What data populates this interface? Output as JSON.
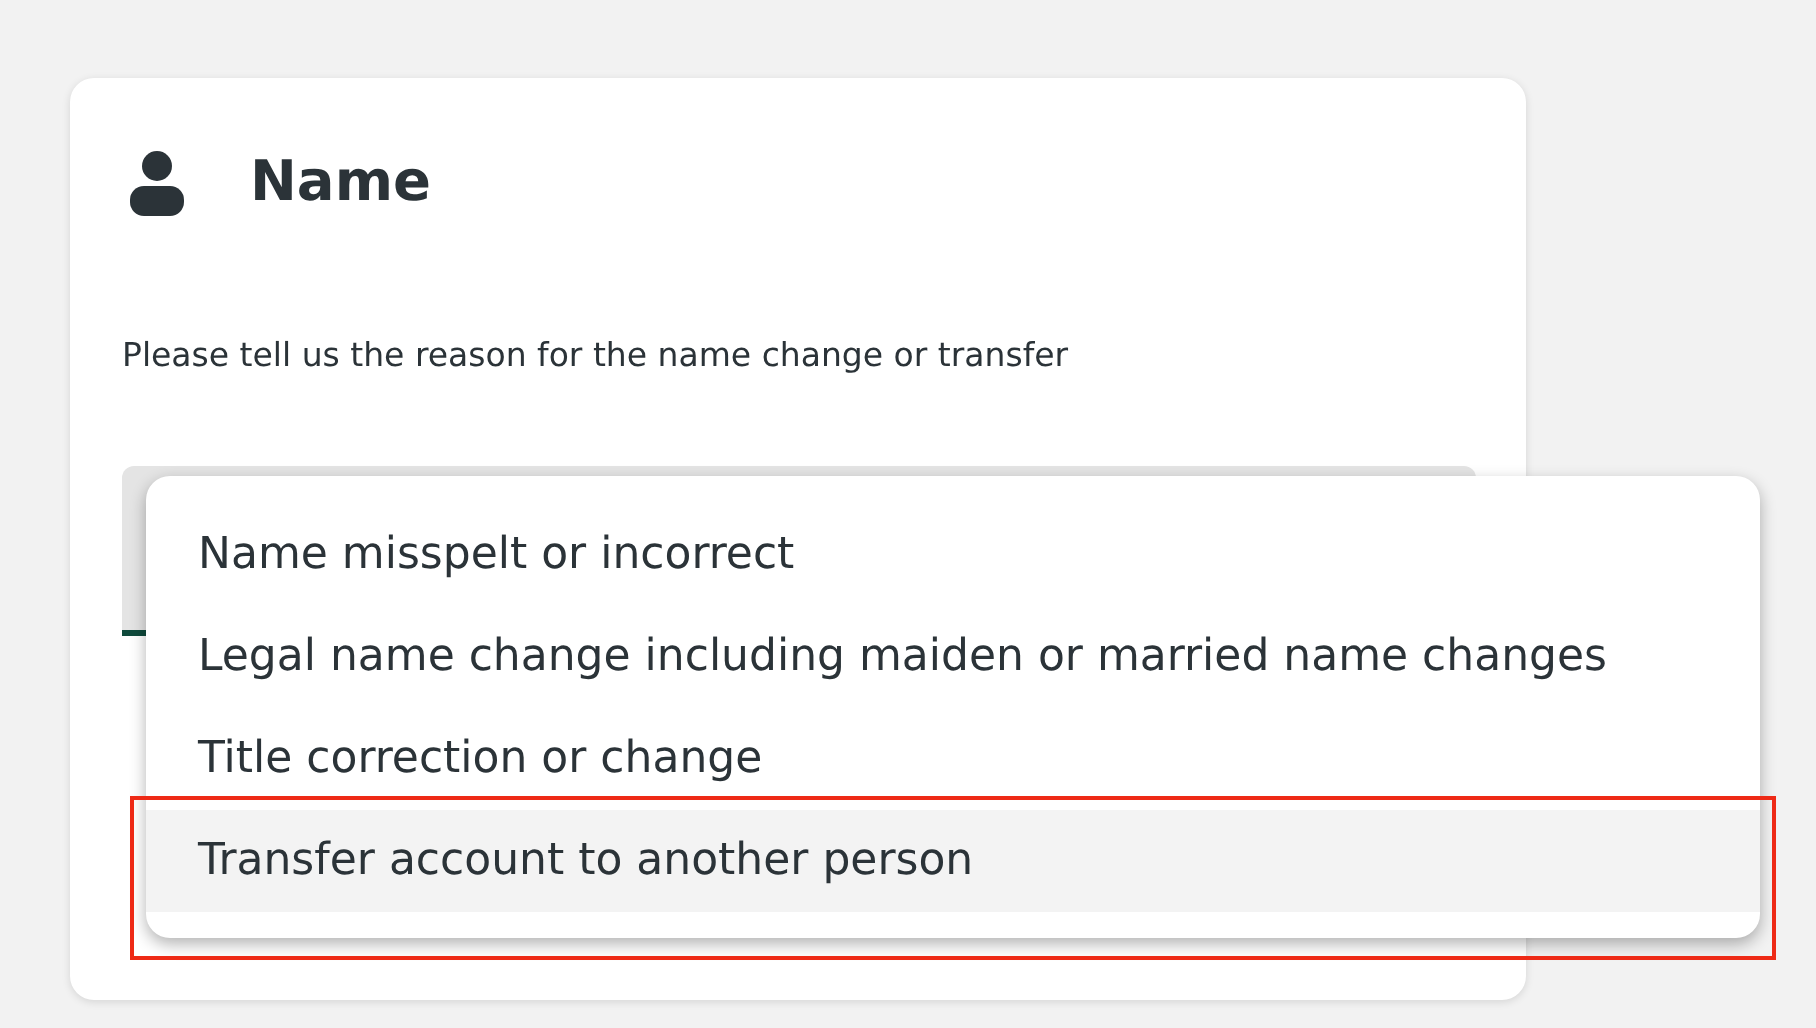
{
  "card": {
    "title": "Name",
    "prompt": "Please tell us the reason for the name change or transfer"
  },
  "dropdown": {
    "expanded": true,
    "options": [
      {
        "label": "Name misspelt or incorrect",
        "selected": false,
        "outlined": false
      },
      {
        "label": "Legal name change including maiden or married name changes",
        "selected": false,
        "outlined": false
      },
      {
        "label": "Title correction or change",
        "selected": false,
        "outlined": false
      },
      {
        "label": "Transfer account to another person",
        "selected": true,
        "outlined": true
      }
    ]
  }
}
